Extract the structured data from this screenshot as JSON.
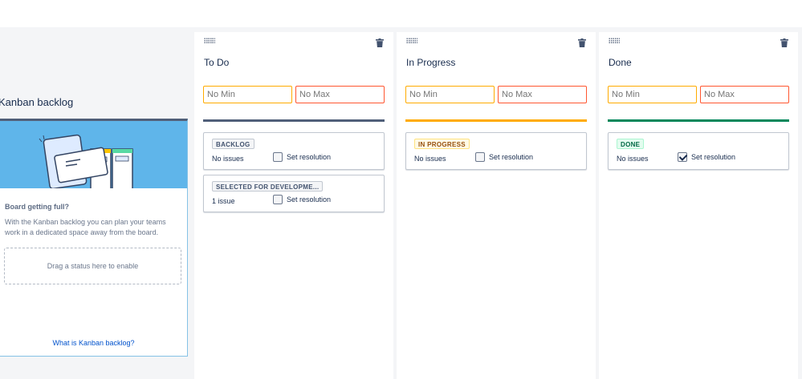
{
  "backlog": {
    "title": "Kanban backlog",
    "heading": "Board getting full?",
    "description": "With the Kanban backlog you can plan your teams work in a dedicated space away from the board.",
    "dropzone_text": "Drag a status here to enable",
    "link_text": "What is Kanban backlog?"
  },
  "columns": [
    {
      "name": "To Do",
      "min_placeholder": "No Min",
      "max_placeholder": "No Max",
      "accent_color": "#505f79",
      "statuses": [
        {
          "label": "BACKLOG",
          "issues": "No issues",
          "resolution_label": "Set resolution",
          "resolution_checked": false
        },
        {
          "label": "SELECTED FOR DEVELOPME...",
          "issues": "1 issue",
          "resolution_label": "Set resolution",
          "resolution_checked": false
        }
      ]
    },
    {
      "name": "In Progress",
      "min_placeholder": "No Min",
      "max_placeholder": "No Max",
      "accent_color": "#ffab00",
      "statuses": [
        {
          "label": "IN PROGRESS",
          "issues": "No issues",
          "resolution_label": "Set resolution",
          "resolution_checked": false
        }
      ]
    },
    {
      "name": "Done",
      "min_placeholder": "No Min",
      "max_placeholder": "No Max",
      "accent_color": "#00875a",
      "statuses": [
        {
          "label": "DONE",
          "issues": "No issues",
          "resolution_label": "Set resolution",
          "resolution_checked": true
        }
      ]
    }
  ],
  "icons": {
    "drag": "drag-handle-icon",
    "delete": "trash-icon",
    "illustration": "kanban-board-illustration"
  }
}
